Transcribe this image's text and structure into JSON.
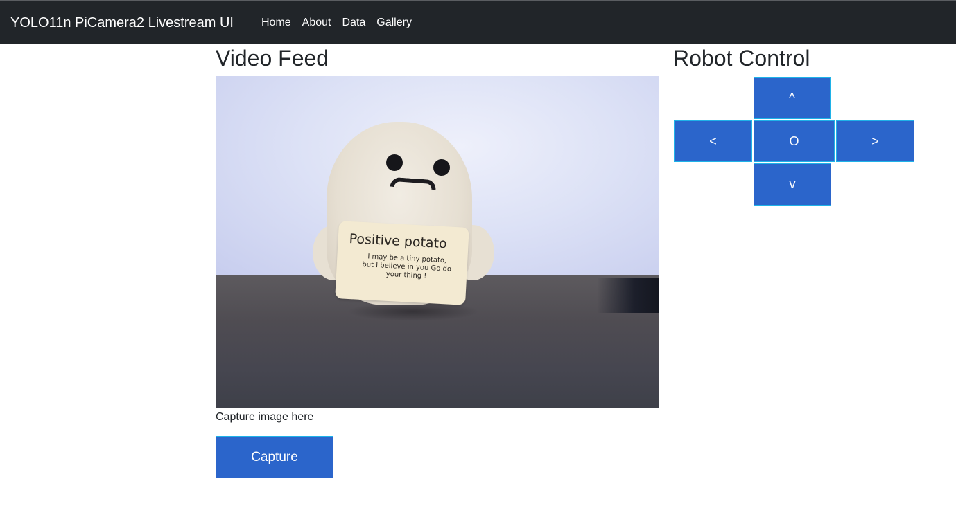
{
  "navbar": {
    "brand": "YOLO11n PiCamera2 Livestream UI",
    "links": [
      "Home",
      "About",
      "Data",
      "Gallery"
    ]
  },
  "video": {
    "heading": "Video Feed",
    "sign_title": "Positive potato",
    "sign_text": "I may be a tiny potato, but I believe in you Go do your thing !",
    "caption": "Capture image here",
    "capture_label": "Capture"
  },
  "robot": {
    "heading": "Robot Control",
    "up": "^",
    "left": "<",
    "stop": "O",
    "right": ">",
    "down": "v"
  },
  "colors": {
    "navbar_bg": "#212529",
    "button_bg": "#2b65cb",
    "button_border": "#1fb2e8"
  }
}
